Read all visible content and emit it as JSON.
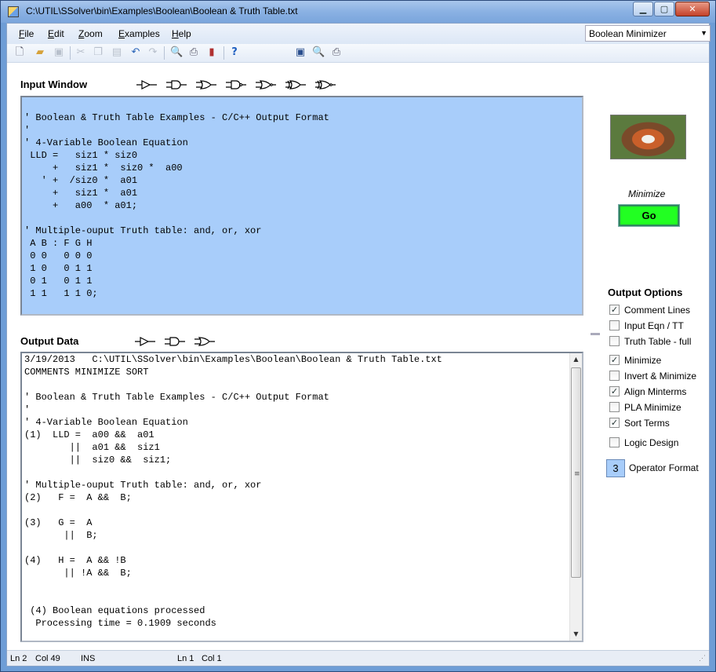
{
  "window": {
    "title": "C:\\UTIL\\SSolver\\bin\\Examples\\Boolean\\Boolean & Truth Table.txt"
  },
  "menu": [
    "File",
    "Edit",
    "Zoom",
    "Examples",
    "Help"
  ],
  "mode_select": {
    "value": "Boolean Minimizer"
  },
  "input_window": {
    "label": "Input Window",
    "lines": [
      "",
      "' Boolean & Truth Table Examples - C/C++ Output Format",
      "'",
      "' 4-Variable Boolean Equation",
      " LLD =   siz1 * siz0",
      "     +   siz1 *  siz0 *  a00",
      "   ' +  /siz0 *  a01",
      "     +   siz1 *  a01",
      "     +   a00  * a01;",
      "",
      "' Multiple-ouput Truth table: and, or, xor",
      " A B : F G H",
      " 0 0   0 0 0",
      " 1 0   0 1 1",
      " 0 1   0 1 1",
      " 1 1   1 1 0;"
    ]
  },
  "output_data": {
    "label": "Output Data",
    "lines": [
      "3/19/2013   C:\\UTIL\\SSolver\\bin\\Examples\\Boolean\\Boolean & Truth Table.txt",
      "COMMENTS MINIMIZE SORT",
      "",
      "' Boolean & Truth Table Examples - C/C++ Output Format",
      "'",
      "' 4-Variable Boolean Equation",
      "(1)  LLD =  a00 &&  a01",
      "        ||  a01 &&  siz1",
      "        ||  siz0 &&  siz1;",
      "",
      "' Multiple-ouput Truth table: and, or, xor",
      "(2)   F =  A &&  B;",
      "",
      "(3)   G =  A",
      "       ||  B;",
      "",
      "(4)   H =  A && !B",
      "       || !A &&  B;",
      "",
      "",
      " (4) Boolean equations processed",
      "  Processing time = 0.1909 seconds"
    ]
  },
  "minimize": {
    "label": "Minimize",
    "button": "Go"
  },
  "output_options": {
    "title": "Output Options",
    "items": [
      {
        "label": "Comment Lines",
        "checked": true
      },
      {
        "label": "Input Eqn / TT",
        "checked": false
      },
      {
        "label": "Truth Table - full",
        "checked": false
      },
      {
        "label": "Minimize",
        "checked": true
      },
      {
        "label": "Invert & Minimize",
        "checked": false
      },
      {
        "label": "Align Minterms",
        "checked": true
      },
      {
        "label": "PLA Minimize",
        "checked": false
      },
      {
        "label": "Sort Terms",
        "checked": true
      },
      {
        "label": "Logic Design",
        "checked": false
      }
    ],
    "operator_format": {
      "value": "3",
      "label": "Operator Format"
    }
  },
  "status": {
    "ln": "Ln 2",
    "col": "Col 49",
    "mode": "INS",
    "ln2": "Ln 1",
    "col2": "Col 1"
  },
  "colors": {
    "input_bg": "#a8cdfa",
    "go_button": "#22ff22"
  }
}
